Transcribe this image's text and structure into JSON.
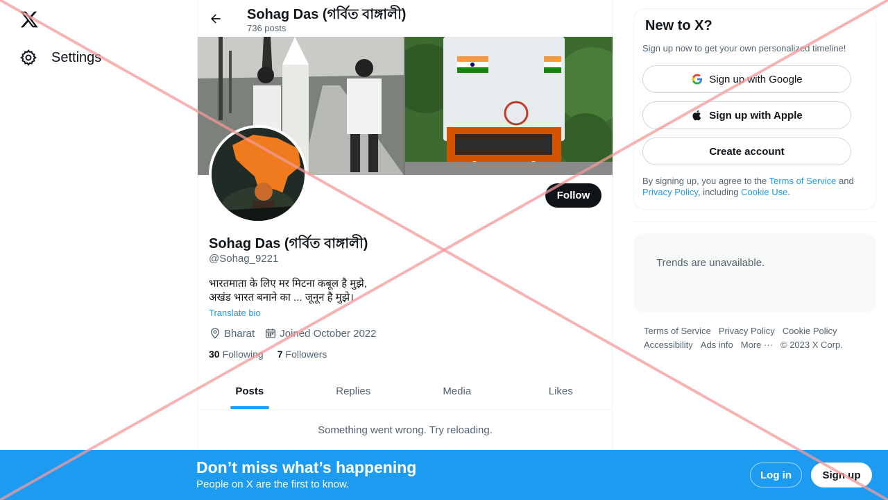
{
  "nav": {
    "settings_label": "Settings"
  },
  "topbar": {
    "name": "Sohag Das (গর্বিত বাঙ্গালী)",
    "post_count": "736 posts"
  },
  "profile": {
    "follow_label": "Follow",
    "name": "Sohag Das (গর্বিত বাঙ্গালী)",
    "handle": "@Sohag_9221",
    "bio_line1": "भारतमाता के लिए मर मिटना कबूल है मुझे,",
    "bio_line2": "अखंड भारत बनाने का ... जूनून है मुझे।",
    "translate_label": "Translate bio",
    "location": "Bharat",
    "joined": "Joined October 2022",
    "following_count": "30",
    "following_label": "Following",
    "followers_count": "7",
    "followers_label": "Followers"
  },
  "tabs": [
    {
      "label": "Posts",
      "active": true
    },
    {
      "label": "Replies"
    },
    {
      "label": "Media"
    },
    {
      "label": "Likes"
    }
  ],
  "feed": {
    "error_text": "Something went wrong. Try reloading."
  },
  "signup": {
    "title": "New to X?",
    "subtitle": "Sign up now to get your own personalized timeline!",
    "google_label": "Sign up with Google",
    "apple_label": "Sign up with Apple",
    "create_label": "Create account",
    "legal_prefix": "By signing up, you agree to the ",
    "terms_link": "Terms of Service",
    "legal_and": " and ",
    "privacy_link": "Privacy Policy",
    "legal_including": ", including ",
    "cookie_link": "Cookie Use",
    "legal_end": "."
  },
  "trends": {
    "text": "Trends are unavailable."
  },
  "footer": {
    "links": [
      "Terms of Service",
      "Privacy Policy",
      "Cookie Policy",
      "Accessibility",
      "Ads info",
      "More ···",
      "© 2023 X Corp."
    ]
  },
  "bottom_bar": {
    "title": "Don’t miss what’s happening",
    "subtitle": "People on X are the first to know.",
    "login_label": "Log in",
    "signup_label": "Sign up"
  },
  "colors": {
    "accent": "#1d9bf0",
    "text": "#0f1419",
    "muted": "#536471",
    "overlay": "#f4a6a6"
  }
}
